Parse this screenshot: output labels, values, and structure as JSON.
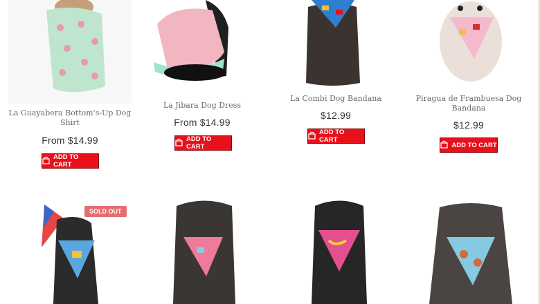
{
  "products": [
    {
      "title": "La Guayabera Bottom's-Up Dog Shirt",
      "price": "From $14.99",
      "button": "ADD TO CART"
    },
    {
      "title": "La Jibara Dog Dress",
      "price": "From $14.99",
      "button": "ADD TO CART"
    },
    {
      "title": "La Combi Dog Bandana",
      "price": "$12.99",
      "button": "ADD TO CART"
    },
    {
      "title": "Piragua de Frambuesa Dog Bandana",
      "price": "$12.99",
      "button": "ADD TO CART"
    }
  ],
  "row2": [
    {
      "badge": "SOLD OUT"
    }
  ],
  "colors": {
    "accent": "#e8101a",
    "badge": "#e46e72"
  }
}
